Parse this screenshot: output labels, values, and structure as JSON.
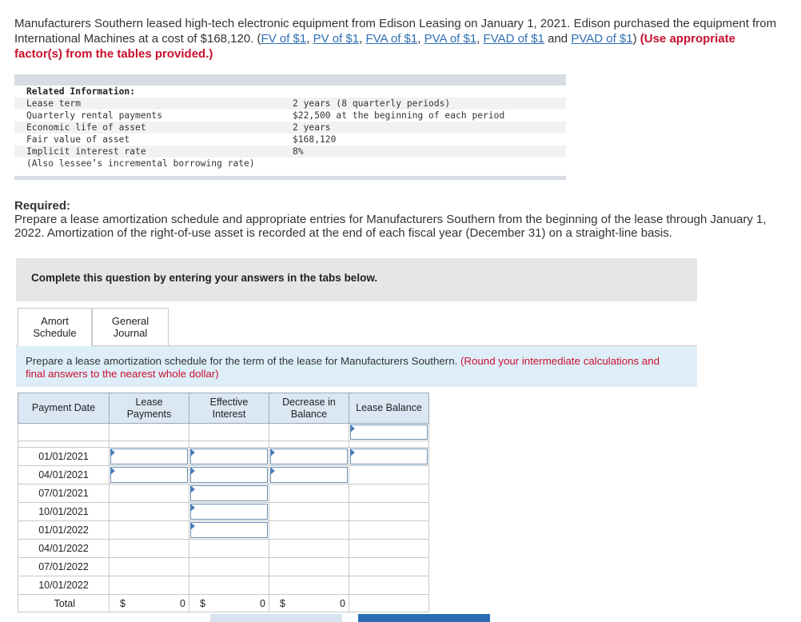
{
  "intro": {
    "text": "Manufacturers Southern leased high-tech electronic equipment from Edison Leasing on January 1, 2021. Edison purchased the equipment from International Machines at a cost of $168,120. (",
    "links": [
      "FV of $1",
      "PV of $1",
      "FVA of $1",
      "PVA of $1",
      "FVAD of $1",
      "PVAD of $1"
    ],
    "and_word": " and ",
    "close": ")",
    "instruction": "(Use appropriate factor(s) from the tables provided.)"
  },
  "related": {
    "heading": "Related Information:",
    "rows": [
      {
        "label": "Lease term",
        "value": "2 years (8 quarterly periods)"
      },
      {
        "label": "Quarterly rental payments",
        "value": "$22,500 at the beginning of each period"
      },
      {
        "label": "Economic life of asset",
        "value": "2 years"
      },
      {
        "label": "Fair value of asset",
        "value": "$168,120"
      },
      {
        "label": "Implicit interest rate",
        "value": "8%"
      },
      {
        "label": "(Also lessee’s incremental borrowing rate)",
        "value": ""
      }
    ]
  },
  "required": {
    "title": "Required:",
    "text": "Prepare a lease amortization schedule and appropriate entries for Manufacturers Southern from the beginning of the lease through January 1, 2022. Amortization of the right-of-use asset is recorded at the end of each fiscal year (December 31) on a straight-line basis."
  },
  "complete_banner": "Complete this question by entering your answers in the tabs below.",
  "tabs": [
    {
      "line1": "Amort",
      "line2": "Schedule"
    },
    {
      "line1": "General",
      "line2": "Journal"
    }
  ],
  "instructions": {
    "text": "Prepare a lease amortization schedule for the term of the lease for Manufacturers Southern. ",
    "note": "(Round your intermediate calculations and final answers to the nearest whole dollar)"
  },
  "table": {
    "headers": [
      {
        "line1": "Payment Date",
        "line2": ""
      },
      {
        "line1": "Lease",
        "line2": "Payments"
      },
      {
        "line1": "Effective",
        "line2": "Interest"
      },
      {
        "line1": "Decrease in",
        "line2": "Balance"
      },
      {
        "line1": "Lease Balance",
        "line2": ""
      }
    ],
    "dates": [
      "01/01/2021",
      "04/01/2021",
      "07/01/2021",
      "10/01/2021",
      "01/01/2022",
      "04/01/2022",
      "07/01/2022",
      "10/01/2022"
    ],
    "total_label": "Total",
    "currency": "$",
    "totals": [
      "0",
      "0",
      "0"
    ]
  }
}
